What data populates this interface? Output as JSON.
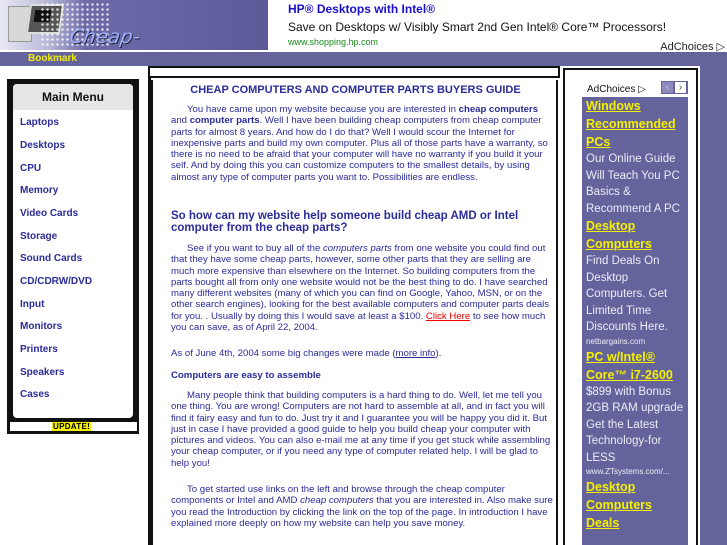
{
  "header": {
    "logo_text": "Cheap-Computers.net",
    "bookmark_label": "Bookmark"
  },
  "top_ad": {
    "title": "HP® Desktops with Intel®",
    "description": "Save on Desktops w/ Visibly Smart 2nd Gen Intel® Core™ Processors!",
    "url": "www.shopping.hp.com",
    "adchoices": "AdChoices ▷"
  },
  "menu": {
    "title": "Main Menu",
    "items": [
      {
        "label": "Laptops"
      },
      {
        "label": "Desktops"
      },
      {
        "label": "CPU"
      },
      {
        "label": "Memory"
      },
      {
        "label": "Video Cards"
      },
      {
        "label": "Storage"
      },
      {
        "label": "Sound Cards"
      },
      {
        "label": "CD/CDRW/DVD"
      },
      {
        "label": "Input"
      },
      {
        "label": "Monitors"
      },
      {
        "label": "Printers"
      },
      {
        "label": "Speakers"
      },
      {
        "label": "Cases"
      }
    ],
    "update_badge": "UPDATE!"
  },
  "content": {
    "title": "CHEAP COMPUTERS AND COMPUTER PARTS BUYERS GUIDE",
    "p1": {
      "a": "You have came upon my website because you are interested in ",
      "b1": "cheap computers",
      "c": " and ",
      "b2": "computer parts",
      "d": ". Well I have been building cheap computers from cheap computer parts for almost 8 years. And how do I do that? Well I would scour the Internet for inexpensive parts and build my own computer. Plus all of those parts have a warranty, so there is no need to be afraid that your computer will have no warranty if you build it your self. And by doing this you can customize computers to the smallest details, by using almost any type of computer parts you want to. Possibilities are endless."
    },
    "h2": "So how can my website help someone build cheap AMD or Intel computer from the cheap parts?",
    "p2": {
      "a": "See if you want to buy all of the ",
      "i": "computers parts",
      "b": " from one website you could find out that they have some cheap parts, however, some other parts that they are selling are much more expensive than elsewhere on the Internet. So building computers from the parts bought all from only one website would not be the best thing to do. I have searched many different websites (many of which you can find on Google, Yahoo, MSN, or on the other search engines), looking for the best available computers and computer parts deals for you. . Usually by doing this I would save at least a $100. ",
      "link": "Click Here",
      "c": " to see how much you can save, as of April 22, 2004."
    },
    "p3": {
      "a": "As of June 4th, 2004 some big changes were made (",
      "link": "more info",
      "b": ")."
    },
    "h3": "Computers are easy to assemble",
    "p4": "Many people think that building computers is a hard thing to do. Well, let me tell you one thing. You are wrong! Computers are not hard to assemble at all, and in fact you will find it fairy easy and fun to do. Just try it and I guarantee you will be happy you did it. But just in case I have provided a good guide to help you build cheap your computer with pictures and videos. You can also e-mail me at any time if you get stuck while assembling your cheap computer, or if you need any type of computer related help. I will be glad to help you!",
    "p5": {
      "a": "To get started use links on the left and browse through the cheap computer components or Intel and AMD ",
      "i": "cheap computers",
      "b": " that you are interested in. Also make sure you read the Introduction by clicking the link on the top of the page. In introduction I have explained more deeply on how my website can help you save money."
    }
  },
  "sidebar": {
    "adchoices": "AdChoices ▷",
    "prev_icon": "‹",
    "next_icon": "›",
    "ads": [
      {
        "title": "Windows Recommended PCs",
        "text": "Our Online Guide Will Teach You PC Basics & Recommend A PC For You.",
        "url": ""
      },
      {
        "title": "Desktop Computers",
        "text": "Find Deals On Desktop Computers. Get Limited Time Discounts Here.",
        "url": "netbargains.com"
      },
      {
        "title": "PC w/Intel® Core™ i7-2600",
        "text": "$899 with Bonus 2GB RAM upgrade Get the Latest Technology-for LESS",
        "url": "www.ZTsystems.com/..."
      },
      {
        "title": "Desktop Computers Deals",
        "text": "",
        "url": ""
      }
    ]
  },
  "colors": {
    "brand_purple": "#65639c",
    "link_blue": "#2b2b9a",
    "accent_yellow": "#f4f000",
    "link_red": "#e00000"
  }
}
